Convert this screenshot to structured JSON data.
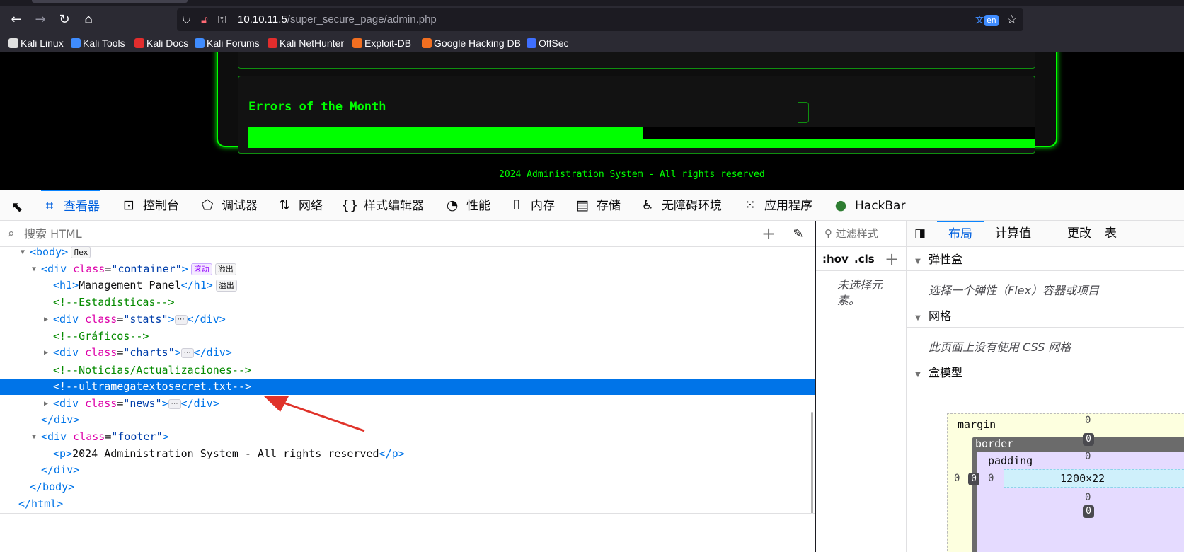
{
  "browser": {
    "url_host": "10.10.11.5",
    "url_path": "/super_secure_page/admin.php",
    "translate_label": "en",
    "bookmarks": [
      {
        "label": "Kali Linux",
        "color": "#e0e0e0"
      },
      {
        "label": "Kali Tools",
        "color": "#3f8cff"
      },
      {
        "label": "Kali Docs",
        "color": "#e22d2d"
      },
      {
        "label": "Kali Forums",
        "color": "#3f8cff"
      },
      {
        "label": "Kali NetHunter",
        "color": "#e22d2d"
      },
      {
        "label": "Exploit-DB",
        "color": "#f26f21"
      },
      {
        "label": "Google Hacking DB",
        "color": "#f26f21"
      },
      {
        "label": "OffSec",
        "color": "#3f6fff"
      }
    ]
  },
  "page": {
    "card_title": "Errors of the Month",
    "errors_bar_fill_fraction": 0.5,
    "footer": "2024 Administration System - All rights reserved",
    "accent": "#00ff00"
  },
  "devtools": {
    "tabs": [
      {
        "label": "查看器",
        "icon": "inspector-icon",
        "selected": true
      },
      {
        "label": "控制台",
        "icon": "console-icon"
      },
      {
        "label": "调试器",
        "icon": "debugger-icon"
      },
      {
        "label": "网络",
        "icon": "network-icon"
      },
      {
        "label": "样式编辑器",
        "icon": "style-editor-icon"
      },
      {
        "label": "性能",
        "icon": "performance-icon"
      },
      {
        "label": "内存",
        "icon": "memory-icon"
      },
      {
        "label": "存储",
        "icon": "storage-icon"
      },
      {
        "label": "无障碍环境",
        "icon": "accessibility-icon"
      },
      {
        "label": "应用程序",
        "icon": "application-icon"
      },
      {
        "label": "HackBar",
        "icon": "hackbar-icon"
      }
    ],
    "search_placeholder": "搜索 HTML",
    "markup": {
      "body_tag": "body",
      "flex_badge": "flex",
      "container_class": "container",
      "scroll_badge": "滚动",
      "overflow_badge": "溢出",
      "h1_text": "Management Panel",
      "comment_stats": "<!--Estadísticas-->",
      "stats_class": "stats",
      "comment_charts": "<!--Gráficos-->",
      "charts_class": "charts",
      "comment_news": "<!--Noticias/Actualizaciones-->",
      "comment_secret": "<!--ultramegatextosecret.txt-->",
      "news_class": "news",
      "footer_class": "footer",
      "footer_p_text": "2024 Administration System - All rights reserved"
    },
    "rules": {
      "filter_placeholder": "过滤样式",
      "hov": ":hov",
      "cls": ".cls",
      "no_element": "未选择元素。"
    },
    "layout": {
      "tabs": [
        {
          "label": "布局",
          "selected": true
        },
        {
          "label": "计算值"
        },
        {
          "label": "更改"
        },
        {
          "label": "表"
        }
      ],
      "flexbox_title": "弹性盒",
      "flexbox_msg": "选择一个弹性（Flex）容器或项目",
      "grid_title": "网格",
      "grid_msg": "此页面上没有使用 CSS 网格",
      "boxmodel_title": "盒模型",
      "box": {
        "margin_label": "margin",
        "border_label": "border",
        "padding_label": "padding",
        "margin_top": "0",
        "margin_left": "0",
        "border_top": "0",
        "border_left": "0",
        "padding_top": "0",
        "padding_left": "0",
        "padding_bottom": "0",
        "content_size": "1200×22"
      }
    }
  }
}
